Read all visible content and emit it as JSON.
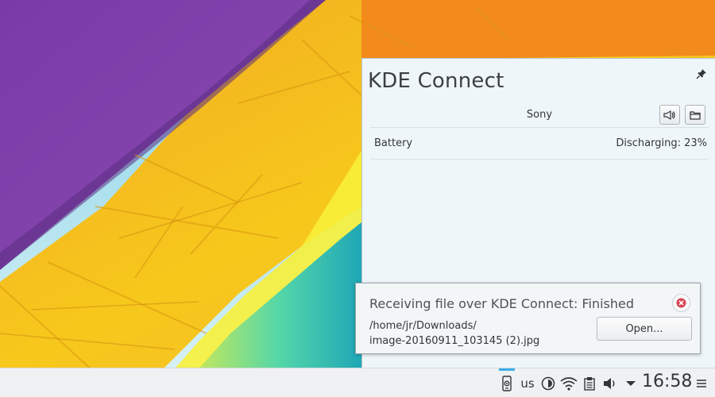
{
  "kdeconnect": {
    "title": "KDE Connect",
    "device": {
      "name": "Sony",
      "ring_icon": "ring-phone-icon",
      "browse_icon": "folder-icon"
    },
    "battery": {
      "label": "Battery",
      "status": "Discharging: 23%"
    }
  },
  "notification": {
    "title": "Receiving file over KDE Connect: Finished",
    "path_line1": "/home/jr/Downloads/",
    "path_line2": "image-20160911_103145 (2).jpg",
    "open_label": "Open..."
  },
  "panel": {
    "keyboard_layout": "us",
    "clock": "16:58",
    "icons": [
      "kdeconnect-icon",
      "keyboard-layout",
      "circle-status-icon",
      "wifi-icon",
      "clipboard-icon",
      "volume-icon",
      "expand-tray-icon",
      "hamburger-menu-icon"
    ],
    "accent": "#3daee9"
  },
  "colors": {
    "wallpaper_purple": "#7b3fa7",
    "wallpaper_yellow": "#f5c518",
    "wallpaper_orange": "#f08a1c",
    "wallpaper_teal": "#2cc9b6"
  }
}
